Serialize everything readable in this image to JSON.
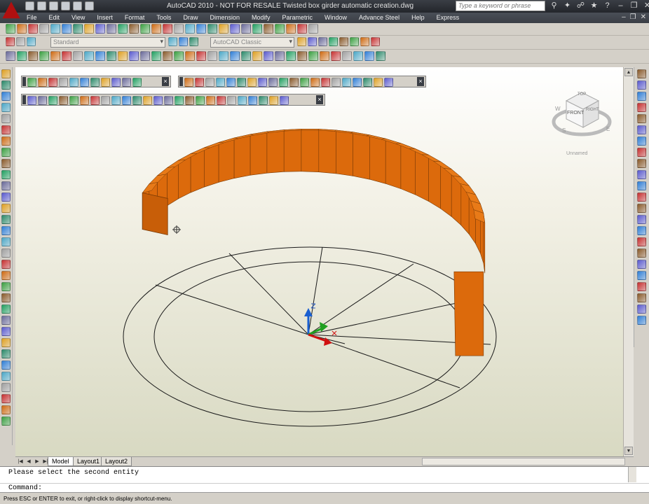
{
  "titlebar": {
    "title": "AutoCAD 2010 - NOT FOR RESALE    Twisted box girder automatic creation.dwg",
    "search_placeholder": "Type a keyword or phrase"
  },
  "menu": {
    "items": [
      "File",
      "Edit",
      "View",
      "Insert",
      "Format",
      "Tools",
      "Draw",
      "Dimension",
      "Modify",
      "Parametric",
      "Window",
      "Advance Steel",
      "Help",
      "Express"
    ]
  },
  "toolbar2": {
    "text_style": "Standard",
    "workspace": "AutoCAD Classic"
  },
  "viewcube": {
    "top": "TOP",
    "front": "FRONT",
    "right": "RIGHT",
    "compass_s": "S",
    "compass_e": "E",
    "compass_w": "W",
    "named_view": "Unnamed"
  },
  "ucs": {
    "z_label": "Z",
    "x_label": "X"
  },
  "tabs": [
    "Model",
    "Layout1",
    "Layout2"
  ],
  "command": {
    "history": "Please select the second entity",
    "prompt": "Command:"
  },
  "statusbar": {
    "hint": "Press ESC or ENTER to exit, or right-click to display shortcut-menu."
  },
  "colors": {
    "girder": "#dc6a0c",
    "girder_edge": "#7a3a05",
    "titlebar": "#2e3238",
    "viewport_top": "#ffffff",
    "viewport_bottom": "#d8d9c2"
  }
}
